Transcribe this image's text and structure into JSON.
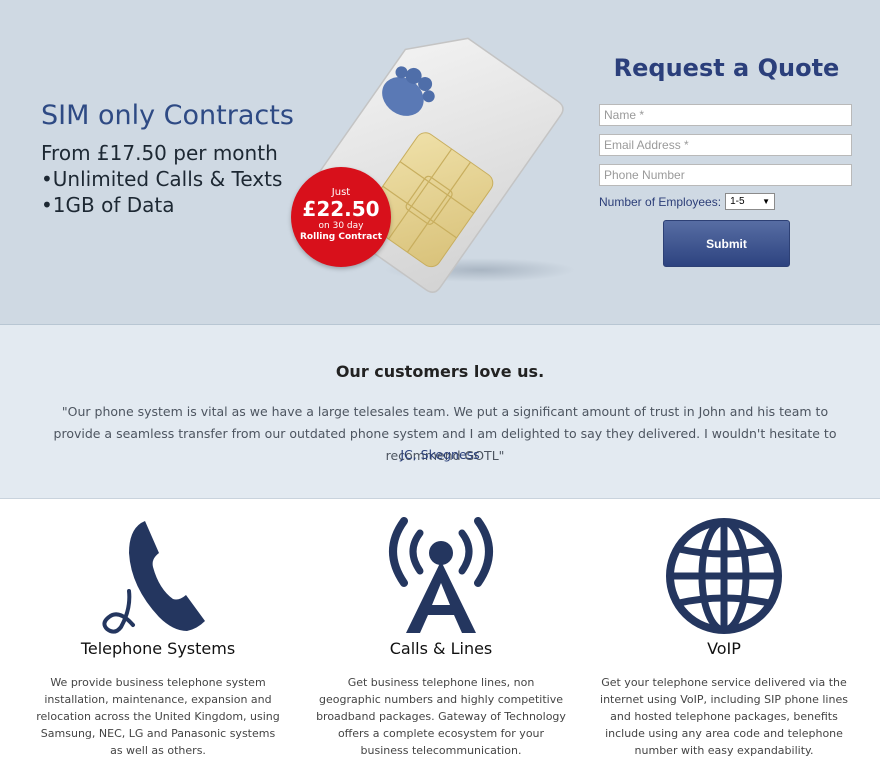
{
  "hero": {
    "title": "SIM only Contracts",
    "line1": "From £17.50 per month",
    "line2": "•Unlimited Calls & Texts",
    "line3": "•1GB of Data",
    "badge": {
      "just": "Just",
      "amount": "£22.50",
      "sub1": "on 30 day",
      "sub2": "Rolling Contract"
    }
  },
  "quote": {
    "title": "Request a Quote",
    "name_placeholder": "Name *",
    "email_placeholder": "Email Address *",
    "phone_placeholder": "Phone Number",
    "employees_label": "Number of Employees:",
    "employees_value": "1-5",
    "submit_label": "Submit"
  },
  "testimonial": {
    "heading": "Our customers love us.",
    "quote": "\"Our phone system is vital as we have a large telesales team. We put a significant amount of trust in John and his team to provide a seamless transfer from our outdated phone system and I am delighted to say they delivered. I wouldn't hesitate to recommend GOTL\"",
    "author": "JC, Skegness"
  },
  "services": [
    {
      "icon": "telephone-icon",
      "title": "Telephone Systems",
      "desc": "We provide business telephone system installation, maintenance, expansion and relocation across the United Kingdom, using Samsung, NEC, LG and Panasonic systems as well as others."
    },
    {
      "icon": "antenna-icon",
      "title": "Calls & Lines",
      "desc": "Get business telephone lines, non geographic numbers and highly competitive broadband packages. Gateway of Technology offers a complete ecosystem for your business telecommunication."
    },
    {
      "icon": "globe-icon",
      "title": "VoIP",
      "desc": "Get your telephone service delivered via the internet using VoIP, including SIP phone lines and hosted telephone packages, benefits include using any area code and telephone number with easy expandability."
    }
  ],
  "colors": {
    "brand_blue": "#2b3f7b",
    "badge_red": "#d8101b",
    "icon_navy": "#24365f"
  }
}
